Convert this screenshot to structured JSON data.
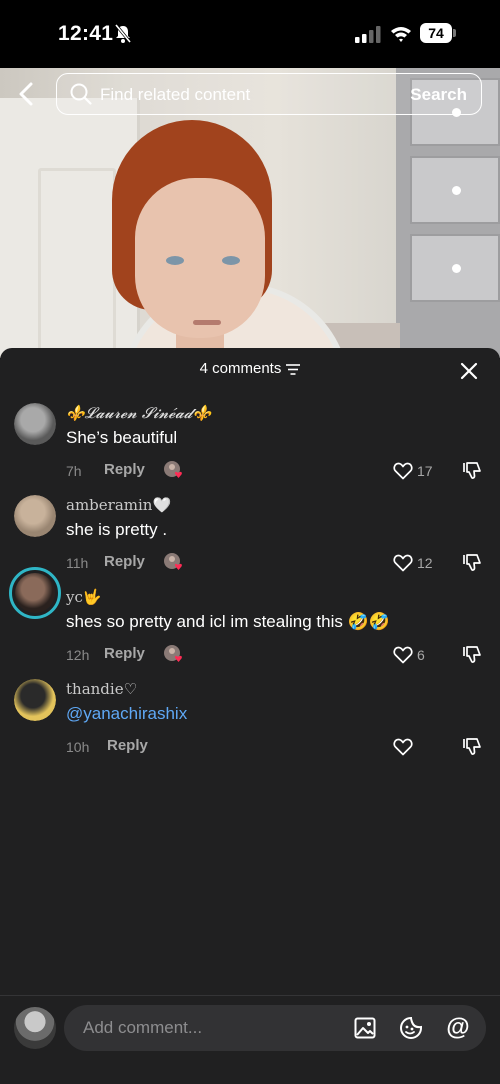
{
  "status_bar": {
    "time": "12:41",
    "battery": "74"
  },
  "search": {
    "placeholder": "Find related content",
    "button_label": "Search"
  },
  "comments_header": {
    "count_label": "4 comments"
  },
  "comments": [
    {
      "username": "⚜️𝓛𝓪𝓾𝓻𝓮𝓷 𝓢𝓲𝓷𝓮́𝓪𝓭⚜️",
      "text": "She’s beautiful",
      "time": "7h",
      "reply_label": "Reply",
      "likes": "17",
      "avatar_colors": [
        "#5a5a5a",
        "#a9a9a9"
      ]
    },
    {
      "username": "amberamin🤍",
      "text": "she is pretty .",
      "time": "11h",
      "reply_label": "Reply",
      "likes": "12",
      "avatar_colors": [
        "#9a8672",
        "#c8b29b"
      ]
    },
    {
      "username": "yc🤟",
      "text": "shes so pretty and icl im stealing this 🤣🤣",
      "time": "12h",
      "reply_label": "Reply",
      "likes": "6",
      "avatar_colors": [
        "#2a211e",
        "#8a6a5a"
      ]
    },
    {
      "username": "thandie♡",
      "text": "@yanachirashix",
      "time": "10h",
      "reply_label": "Reply",
      "likes": "",
      "avatar_colors": [
        "#e3c35b",
        "#2a2a2a"
      ]
    }
  ],
  "composer": {
    "placeholder": "Add comment...",
    "mention_symbol": "@"
  }
}
